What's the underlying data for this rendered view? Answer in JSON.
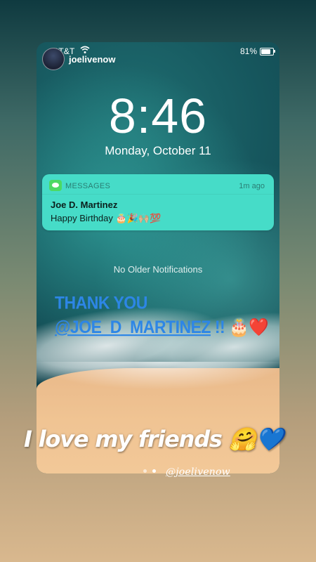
{
  "status_bar": {
    "carrier": "AT&T",
    "battery": "81%",
    "battery_level": 0.81
  },
  "story": {
    "username": "joelivenow",
    "page_dots": {
      "count": 2,
      "active_index": 1
    },
    "mention_sticker": "@joelivenow"
  },
  "lockscreen": {
    "time": "8:46",
    "date": "Monday, October 11",
    "notification": {
      "app": "MESSAGES",
      "ago": "1m ago",
      "sender": "Joe D. Martinez",
      "body": "Happy Birthday 🎂🎉🙌🏼💯"
    },
    "no_older": "No Older Notifications"
  },
  "overlay": {
    "thanks_line1": "THANK YOU",
    "thanks_line2": "@JOE_D_MARTINEZ",
    "thanks_suffix": " !! 🎂❤️",
    "love": "I love my friends 🤗💙"
  },
  "colors": {
    "notification_bg": "#46dcc8",
    "thanks_text": "#2d86e6"
  }
}
